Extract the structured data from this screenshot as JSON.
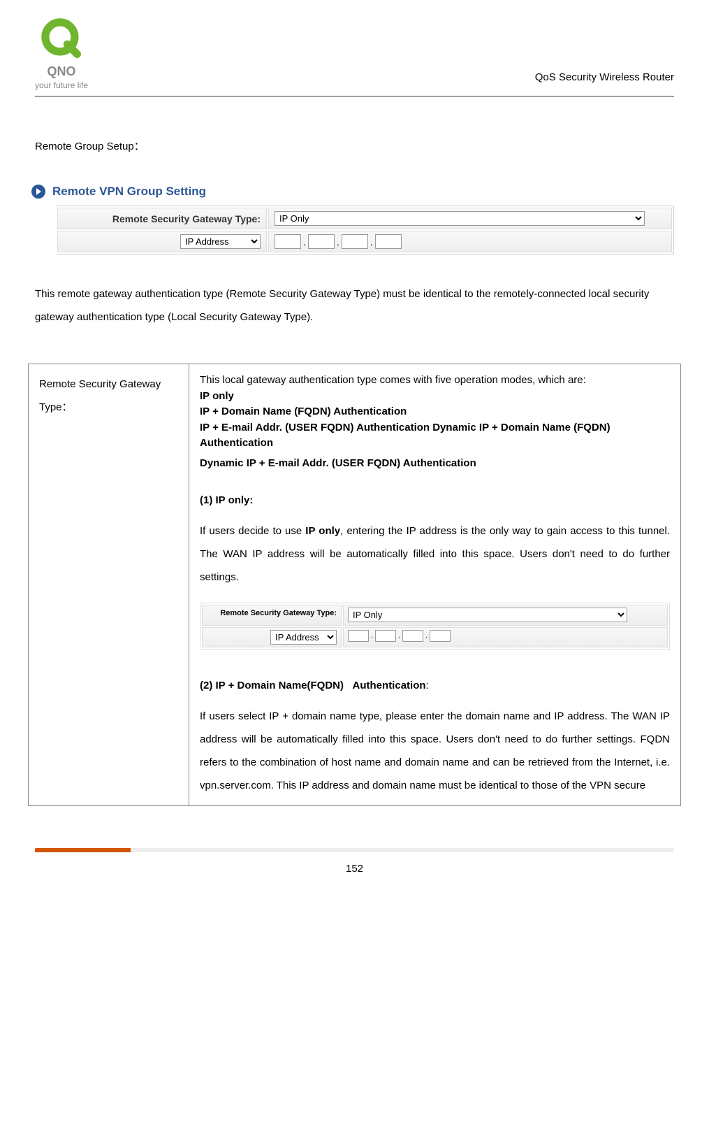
{
  "header": {
    "brand_name": "QNO",
    "tagline": "your future life",
    "product_name": "QoS Security Wireless Router"
  },
  "section": {
    "title": "Remote Group Setup：",
    "panel_heading": "Remote VPN Group Setting"
  },
  "form1": {
    "gateway_type_label": "Remote Security Gateway Type:",
    "gateway_type_value": "IP Only",
    "ip_mode_value": "IP Address"
  },
  "paragraph1": "This remote gateway authentication type (Remote Security Gateway Type) must be identical to the remotely-connected local security gateway authentication type (Local Security Gateway Type).",
  "table": {
    "left_label": "Remote Security Gateway Type：",
    "intro": "This local gateway authentication type comes with five operation modes, which are:",
    "modes": {
      "m1": "IP only",
      "m2": "IP + Domain Name (FQDN) Authentication",
      "m3": "IP + E-mail Addr. (USER FQDN) Authentication Dynamic IP + Domain Name (FQDN) Authentication",
      "m4": "Dynamic IP + E-mail Addr. (USER FQDN) Authentication"
    },
    "sec1_title": "(1) IP only:",
    "sec1_p_pre": "If users decide to use ",
    "sec1_p_bold": "IP only",
    "sec1_p_post": ", entering the IP address is the only way to gain access to this tunnel. The WAN IP address will be automatically filled into this space. Users don't need to do further settings.",
    "inner_form": {
      "gateway_type_label": "Remote Security Gateway Type:",
      "gateway_type_value": "IP Only",
      "ip_mode_value": "IP Address"
    },
    "sec2_title_a": "(2) IP + Domain Name(FQDN)",
    "sec2_title_b": "Authentication",
    "sec2_p": "If users select IP + domain name type, please enter the domain name and IP address. The WAN IP address will be automatically filled into this space. Users don't need to do further settings. FQDN refers to the combination of host name and domain name and can be retrieved from the Internet, i.e. vpn.server.com. This IP address and domain name must be identical to those of the VPN secure"
  },
  "page_number": "152"
}
